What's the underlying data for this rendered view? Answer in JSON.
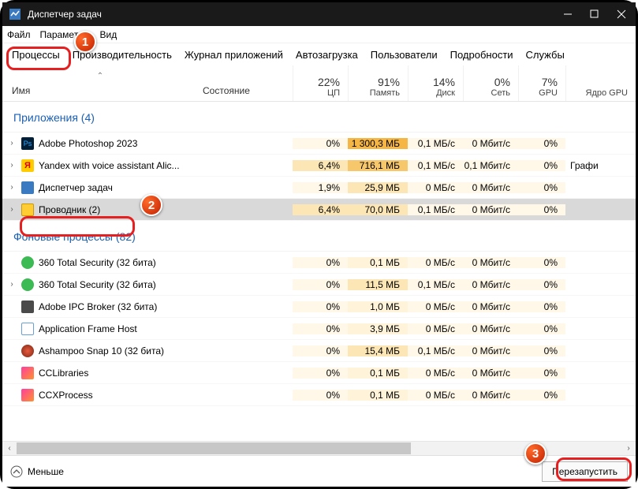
{
  "titlebar": {
    "title": "Диспетчер задач"
  },
  "menu": {
    "file": "Файл",
    "options": "Параметры",
    "view": "Вид"
  },
  "tabs": {
    "processes": "Процессы",
    "performance": "Производительность",
    "apphistory": "Журнал приложений",
    "startup": "Автозагрузка",
    "users": "Пользователи",
    "details": "Подробности",
    "services": "Службы"
  },
  "columns": {
    "name": "Имя",
    "state": "Состояние",
    "cpu": {
      "pct": "22%",
      "lbl": "ЦП"
    },
    "mem": {
      "pct": "91%",
      "lbl": "Память"
    },
    "disk": {
      "pct": "14%",
      "lbl": "Диск"
    },
    "net": {
      "pct": "0%",
      "lbl": "Сеть"
    },
    "gpu": {
      "pct": "7%",
      "lbl": "GPU"
    },
    "gpucore": {
      "pct": "",
      "lbl": "Ядро GPU"
    }
  },
  "groups": {
    "apps": "Приложения (4)",
    "bg": "Фоновые процессы (82)"
  },
  "rows": {
    "photoshop": {
      "name": "Adobe Photoshop 2023",
      "cpu": "0%",
      "mem": "1 300,3 МБ",
      "disk": "0,1 МБ/с",
      "net": "0 Мбит/с",
      "gpu": "0%",
      "gpucore": ""
    },
    "yandex": {
      "name": "Yandex with voice assistant Alic...",
      "cpu": "6,4%",
      "mem": "716,1 МБ",
      "disk": "0,1 МБ/с",
      "net": "0,1 Мбит/с",
      "gpu": "0%",
      "gpucore": "Графи"
    },
    "taskmgr": {
      "name": "Диспетчер задач",
      "cpu": "1,9%",
      "mem": "25,9 МБ",
      "disk": "0 МБ/с",
      "net": "0 Мбит/с",
      "gpu": "0%",
      "gpucore": ""
    },
    "explorer": {
      "name": "Проводник (2)",
      "cpu": "6,4%",
      "mem": "70,0 МБ",
      "disk": "0,1 МБ/с",
      "net": "0 Мбит/с",
      "gpu": "0%",
      "gpucore": ""
    },
    "ts360a": {
      "name": "360 Total Security (32 бита)",
      "cpu": "0%",
      "mem": "0,1 МБ",
      "disk": "0 МБ/с",
      "net": "0 Мбит/с",
      "gpu": "0%",
      "gpucore": ""
    },
    "ts360b": {
      "name": "360 Total Security (32 бита)",
      "cpu": "0%",
      "mem": "11,5 МБ",
      "disk": "0,1 МБ/с",
      "net": "0 Мбит/с",
      "gpu": "0%",
      "gpucore": ""
    },
    "ipcbroker": {
      "name": "Adobe IPC Broker (32 бита)",
      "cpu": "0%",
      "mem": "1,0 МБ",
      "disk": "0 МБ/с",
      "net": "0 Мбит/с",
      "gpu": "0%",
      "gpucore": ""
    },
    "appframe": {
      "name": "Application Frame Host",
      "cpu": "0%",
      "mem": "3,9 МБ",
      "disk": "0 МБ/с",
      "net": "0 Мбит/с",
      "gpu": "0%",
      "gpucore": ""
    },
    "ashampoo": {
      "name": "Ashampoo Snap 10 (32 бита)",
      "cpu": "0%",
      "mem": "15,4 МБ",
      "disk": "0,1 МБ/с",
      "net": "0 Мбит/с",
      "gpu": "0%",
      "gpucore": ""
    },
    "cclib": {
      "name": "CCLibraries",
      "cpu": "0%",
      "mem": "0,1 МБ",
      "disk": "0 МБ/с",
      "net": "0 Мбит/с",
      "gpu": "0%",
      "gpucore": ""
    },
    "ccxproc": {
      "name": "CCXProcess",
      "cpu": "0%",
      "mem": "0,1 МБ",
      "disk": "0 МБ/с",
      "net": "0 Мбит/с",
      "gpu": "0%",
      "gpucore": ""
    }
  },
  "footer": {
    "less": "Меньше",
    "restart": "Перезапустить"
  },
  "callouts": {
    "n1": "1",
    "n2": "2",
    "n3": "3"
  }
}
